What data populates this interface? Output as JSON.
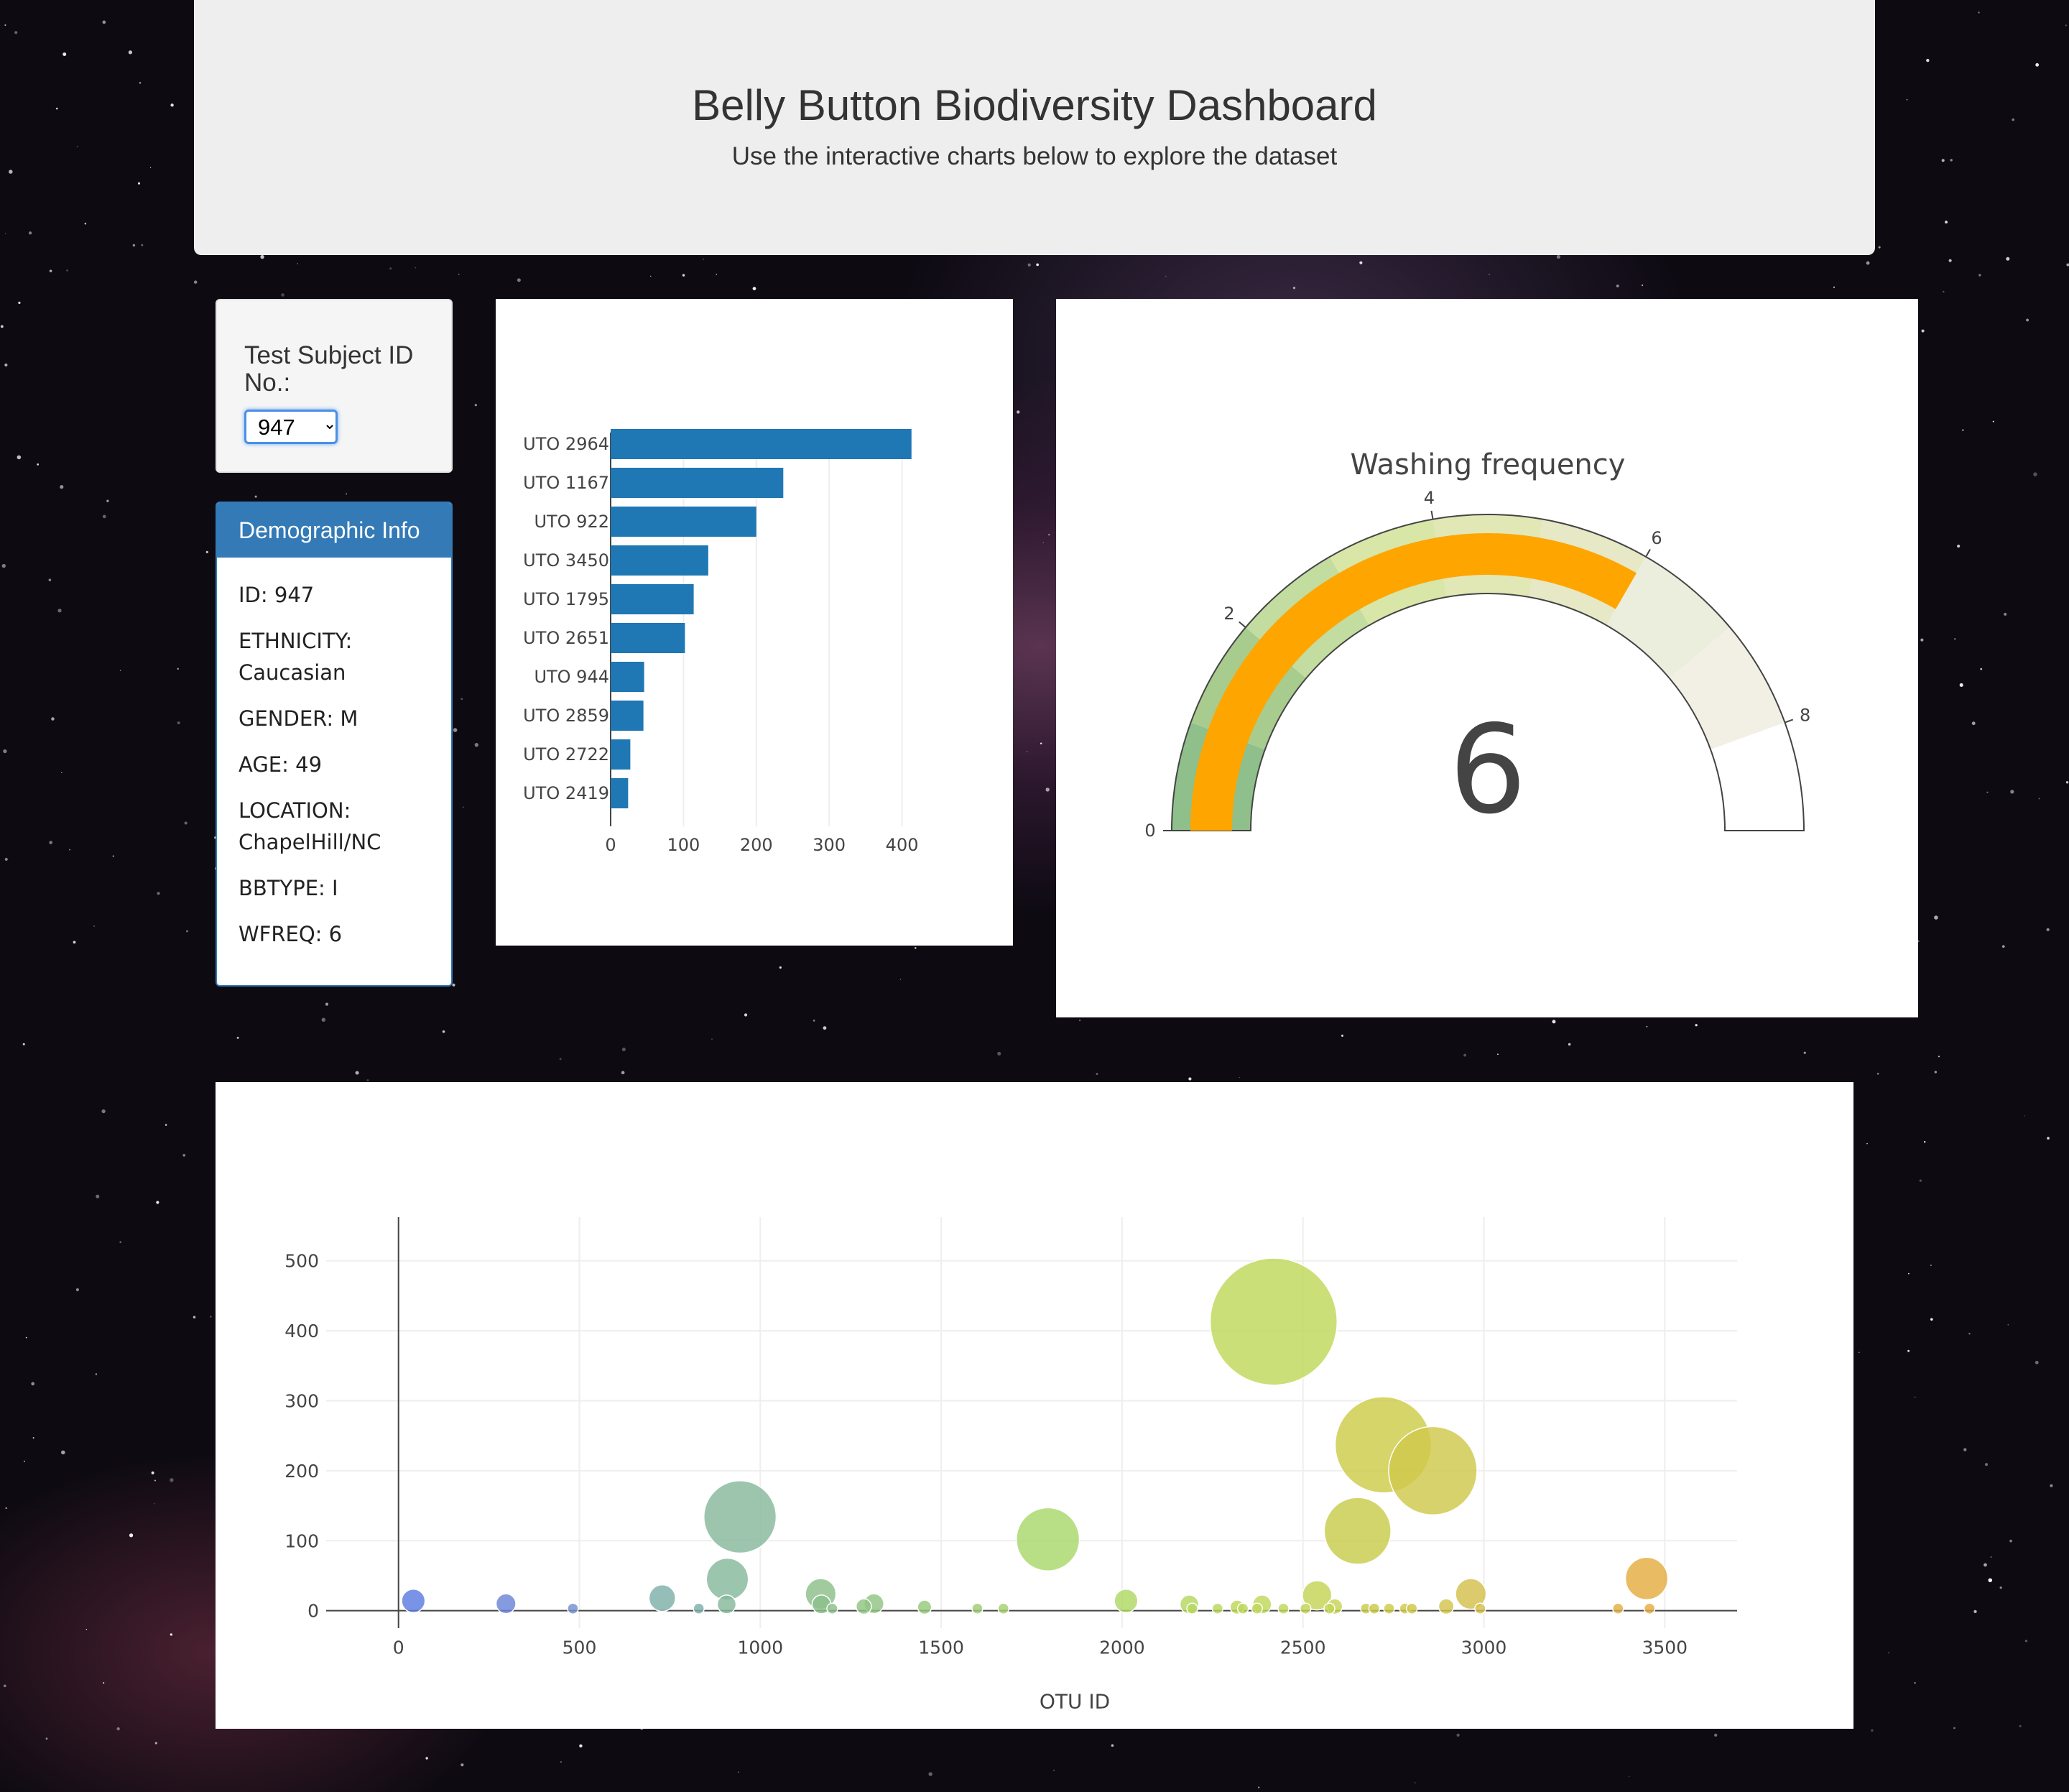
{
  "header": {
    "title": "Belly Button Biodiversity Dashboard",
    "subtitle": "Use the interactive charts below to explore the dataset"
  },
  "selector": {
    "label": "Test Subject ID No.:",
    "value": "947"
  },
  "demographics": {
    "heading": "Demographic Info",
    "rows": [
      "ID: 947",
      "ETHNICITY: Caucasian",
      "GENDER: M",
      "AGE: 49",
      "LOCATION: ChapelHill/NC",
      "BBTYPE: I",
      "WFREQ: 6"
    ]
  },
  "chart_data": [
    {
      "type": "bar",
      "orientation": "horizontal",
      "categories": [
        "UTO 2964",
        "UTO 1167",
        "UTO 922",
        "UTO 3450",
        "UTO 1795",
        "UTO 2651",
        "UTO 944",
        "UTO 2859",
        "UTO 2722",
        "UTO 2419"
      ],
      "values": [
        413,
        237,
        200,
        134,
        114,
        102,
        46,
        45,
        27,
        24
      ],
      "xlim": [
        0,
        430
      ],
      "xticks": [
        0,
        100,
        200,
        300,
        400
      ],
      "color": "#1f77b4",
      "grid": true
    },
    {
      "type": "gauge",
      "title": "Washing frequency",
      "value": 6,
      "range": [
        0,
        9
      ],
      "ticks": [
        0,
        2,
        4,
        6,
        8
      ],
      "bar_color": "#ffa500",
      "steps": [
        {
          "range": [
            0,
            1
          ],
          "color": "#8fbf8a"
        },
        {
          "range": [
            1,
            2
          ],
          "color": "#a8cc8e"
        },
        {
          "range": [
            2,
            3
          ],
          "color": "#c3dca0"
        },
        {
          "range": [
            3,
            4
          ],
          "color": "#d8e6a8"
        },
        {
          "range": [
            4,
            5
          ],
          "color": "#e1e8b5"
        },
        {
          "range": [
            5,
            6
          ],
          "color": "#e6e8c6"
        },
        {
          "range": [
            6,
            7
          ],
          "color": "#eceedd"
        },
        {
          "range": [
            7,
            8
          ],
          "color": "#f2f0e4"
        },
        {
          "range": [
            8,
            9
          ],
          "color": "#ffffff"
        }
      ]
    },
    {
      "type": "scatter",
      "xlabel": "OTU ID",
      "xlim": [
        -200,
        3700
      ],
      "ylim": [
        -25,
        550
      ],
      "xticks": [
        0,
        500,
        1000,
        1500,
        2000,
        2500,
        3000,
        3500
      ],
      "yticks": [
        0,
        100,
        200,
        300,
        400,
        500
      ],
      "grid": true,
      "points": [
        {
          "x": 41,
          "y": 14,
          "color": "#5b7be0"
        },
        {
          "x": 297,
          "y": 10,
          "color": "#6a84d8"
        },
        {
          "x": 482,
          "y": 3,
          "color": "#7390d0"
        },
        {
          "x": 729,
          "y": 18,
          "color": "#7fb0a8"
        },
        {
          "x": 830,
          "y": 3,
          "color": "#7fb0a8"
        },
        {
          "x": 909,
          "y": 45,
          "color": "#86b89c"
        },
        {
          "x": 907,
          "y": 9,
          "color": "#86b89c"
        },
        {
          "x": 944,
          "y": 134,
          "color": "#88b89c"
        },
        {
          "x": 1167,
          "y": 24,
          "color": "#8cc08a"
        },
        {
          "x": 1169,
          "y": 9,
          "color": "#8cc08a"
        },
        {
          "x": 1199,
          "y": 3,
          "color": "#8cc08a"
        },
        {
          "x": 1286,
          "y": 6,
          "color": "#90c482"
        },
        {
          "x": 1314,
          "y": 10,
          "color": "#90c482"
        },
        {
          "x": 1454,
          "y": 5,
          "color": "#96c87e"
        },
        {
          "x": 1600,
          "y": 3,
          "color": "#a0cc76"
        },
        {
          "x": 1672,
          "y": 3,
          "color": "#a6d070"
        },
        {
          "x": 1795,
          "y": 102,
          "color": "#a8d86a"
        },
        {
          "x": 2011,
          "y": 14,
          "color": "#b0d864"
        },
        {
          "x": 2186,
          "y": 9,
          "color": "#b6d860"
        },
        {
          "x": 2194,
          "y": 3,
          "color": "#b6d860"
        },
        {
          "x": 2264,
          "y": 3,
          "color": "#bad85c"
        },
        {
          "x": 2318,
          "y": 5,
          "color": "#bcd85a"
        },
        {
          "x": 2334,
          "y": 3,
          "color": "#bcd85a"
        },
        {
          "x": 2373,
          "y": 3,
          "color": "#bed858"
        },
        {
          "x": 2387,
          "y": 9,
          "color": "#bed858"
        },
        {
          "x": 2419,
          "y": 413,
          "color": "#c0d85a"
        },
        {
          "x": 2446,
          "y": 3,
          "color": "#c0d85a"
        },
        {
          "x": 2507,
          "y": 3,
          "color": "#c2d456"
        },
        {
          "x": 2539,
          "y": 22,
          "color": "#c4d456"
        },
        {
          "x": 2573,
          "y": 3,
          "color": "#c4d456"
        },
        {
          "x": 2588,
          "y": 6,
          "color": "#c6d454"
        },
        {
          "x": 2651,
          "y": 114,
          "color": "#c8cc4a"
        },
        {
          "x": 2674,
          "y": 3,
          "color": "#c8cc4a"
        },
        {
          "x": 2697,
          "y": 3,
          "color": "#caca48"
        },
        {
          "x": 2722,
          "y": 237,
          "color": "#cccc48"
        },
        {
          "x": 2738,
          "y": 3,
          "color": "#cccc48"
        },
        {
          "x": 2782,
          "y": 3,
          "color": "#cec848"
        },
        {
          "x": 2801,
          "y": 3,
          "color": "#cec848"
        },
        {
          "x": 2859,
          "y": 200,
          "color": "#d0c84c"
        },
        {
          "x": 2896,
          "y": 6,
          "color": "#d2c44c"
        },
        {
          "x": 2964,
          "y": 24,
          "color": "#d4c04c"
        },
        {
          "x": 2990,
          "y": 3,
          "color": "#d4c04c"
        },
        {
          "x": 3371,
          "y": 3,
          "color": "#e0b046"
        },
        {
          "x": 3450,
          "y": 46,
          "color": "#e4ac40"
        },
        {
          "x": 3458,
          "y": 3,
          "color": "#e4ac40"
        }
      ]
    }
  ]
}
